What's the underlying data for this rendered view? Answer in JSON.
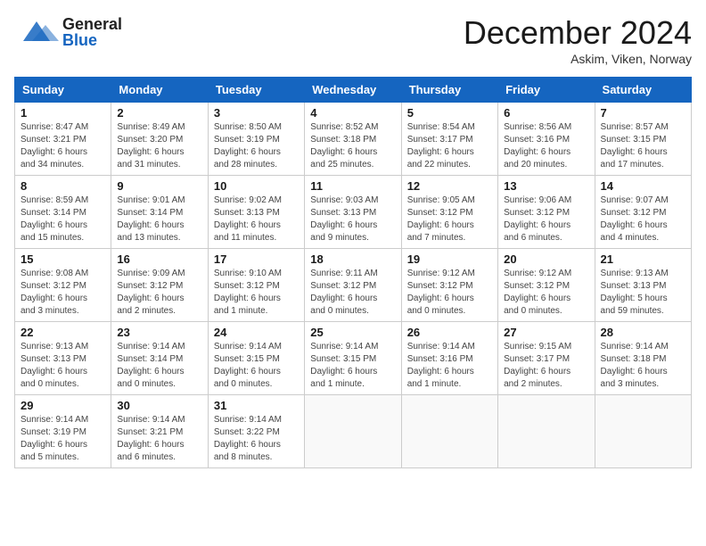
{
  "header": {
    "logo_general": "General",
    "logo_blue": "Blue",
    "month": "December 2024",
    "location": "Askim, Viken, Norway"
  },
  "calendar": {
    "days_of_week": [
      "Sunday",
      "Monday",
      "Tuesday",
      "Wednesday",
      "Thursday",
      "Friday",
      "Saturday"
    ],
    "weeks": [
      [
        {
          "day": "1",
          "info": "Sunrise: 8:47 AM\nSunset: 3:21 PM\nDaylight: 6 hours\nand 34 minutes."
        },
        {
          "day": "2",
          "info": "Sunrise: 8:49 AM\nSunset: 3:20 PM\nDaylight: 6 hours\nand 31 minutes."
        },
        {
          "day": "3",
          "info": "Sunrise: 8:50 AM\nSunset: 3:19 PM\nDaylight: 6 hours\nand 28 minutes."
        },
        {
          "day": "4",
          "info": "Sunrise: 8:52 AM\nSunset: 3:18 PM\nDaylight: 6 hours\nand 25 minutes."
        },
        {
          "day": "5",
          "info": "Sunrise: 8:54 AM\nSunset: 3:17 PM\nDaylight: 6 hours\nand 22 minutes."
        },
        {
          "day": "6",
          "info": "Sunrise: 8:56 AM\nSunset: 3:16 PM\nDaylight: 6 hours\nand 20 minutes."
        },
        {
          "day": "7",
          "info": "Sunrise: 8:57 AM\nSunset: 3:15 PM\nDaylight: 6 hours\nand 17 minutes."
        }
      ],
      [
        {
          "day": "8",
          "info": "Sunrise: 8:59 AM\nSunset: 3:14 PM\nDaylight: 6 hours\nand 15 minutes."
        },
        {
          "day": "9",
          "info": "Sunrise: 9:01 AM\nSunset: 3:14 PM\nDaylight: 6 hours\nand 13 minutes."
        },
        {
          "day": "10",
          "info": "Sunrise: 9:02 AM\nSunset: 3:13 PM\nDaylight: 6 hours\nand 11 minutes."
        },
        {
          "day": "11",
          "info": "Sunrise: 9:03 AM\nSunset: 3:13 PM\nDaylight: 6 hours\nand 9 minutes."
        },
        {
          "day": "12",
          "info": "Sunrise: 9:05 AM\nSunset: 3:12 PM\nDaylight: 6 hours\nand 7 minutes."
        },
        {
          "day": "13",
          "info": "Sunrise: 9:06 AM\nSunset: 3:12 PM\nDaylight: 6 hours\nand 6 minutes."
        },
        {
          "day": "14",
          "info": "Sunrise: 9:07 AM\nSunset: 3:12 PM\nDaylight: 6 hours\nand 4 minutes."
        }
      ],
      [
        {
          "day": "15",
          "info": "Sunrise: 9:08 AM\nSunset: 3:12 PM\nDaylight: 6 hours\nand 3 minutes."
        },
        {
          "day": "16",
          "info": "Sunrise: 9:09 AM\nSunset: 3:12 PM\nDaylight: 6 hours\nand 2 minutes."
        },
        {
          "day": "17",
          "info": "Sunrise: 9:10 AM\nSunset: 3:12 PM\nDaylight: 6 hours\nand 1 minute."
        },
        {
          "day": "18",
          "info": "Sunrise: 9:11 AM\nSunset: 3:12 PM\nDaylight: 6 hours\nand 0 minutes."
        },
        {
          "day": "19",
          "info": "Sunrise: 9:12 AM\nSunset: 3:12 PM\nDaylight: 6 hours\nand 0 minutes."
        },
        {
          "day": "20",
          "info": "Sunrise: 9:12 AM\nSunset: 3:12 PM\nDaylight: 6 hours\nand 0 minutes."
        },
        {
          "day": "21",
          "info": "Sunrise: 9:13 AM\nSunset: 3:13 PM\nDaylight: 5 hours\nand 59 minutes."
        }
      ],
      [
        {
          "day": "22",
          "info": "Sunrise: 9:13 AM\nSunset: 3:13 PM\nDaylight: 6 hours\nand 0 minutes."
        },
        {
          "day": "23",
          "info": "Sunrise: 9:14 AM\nSunset: 3:14 PM\nDaylight: 6 hours\nand 0 minutes."
        },
        {
          "day": "24",
          "info": "Sunrise: 9:14 AM\nSunset: 3:15 PM\nDaylight: 6 hours\nand 0 minutes."
        },
        {
          "day": "25",
          "info": "Sunrise: 9:14 AM\nSunset: 3:15 PM\nDaylight: 6 hours\nand 1 minute."
        },
        {
          "day": "26",
          "info": "Sunrise: 9:14 AM\nSunset: 3:16 PM\nDaylight: 6 hours\nand 1 minute."
        },
        {
          "day": "27",
          "info": "Sunrise: 9:15 AM\nSunset: 3:17 PM\nDaylight: 6 hours\nand 2 minutes."
        },
        {
          "day": "28",
          "info": "Sunrise: 9:14 AM\nSunset: 3:18 PM\nDaylight: 6 hours\nand 3 minutes."
        }
      ],
      [
        {
          "day": "29",
          "info": "Sunrise: 9:14 AM\nSunset: 3:19 PM\nDaylight: 6 hours\nand 5 minutes."
        },
        {
          "day": "30",
          "info": "Sunrise: 9:14 AM\nSunset: 3:21 PM\nDaylight: 6 hours\nand 6 minutes."
        },
        {
          "day": "31",
          "info": "Sunrise: 9:14 AM\nSunset: 3:22 PM\nDaylight: 6 hours\nand 8 minutes."
        },
        {
          "day": "",
          "info": ""
        },
        {
          "day": "",
          "info": ""
        },
        {
          "day": "",
          "info": ""
        },
        {
          "day": "",
          "info": ""
        }
      ]
    ]
  }
}
